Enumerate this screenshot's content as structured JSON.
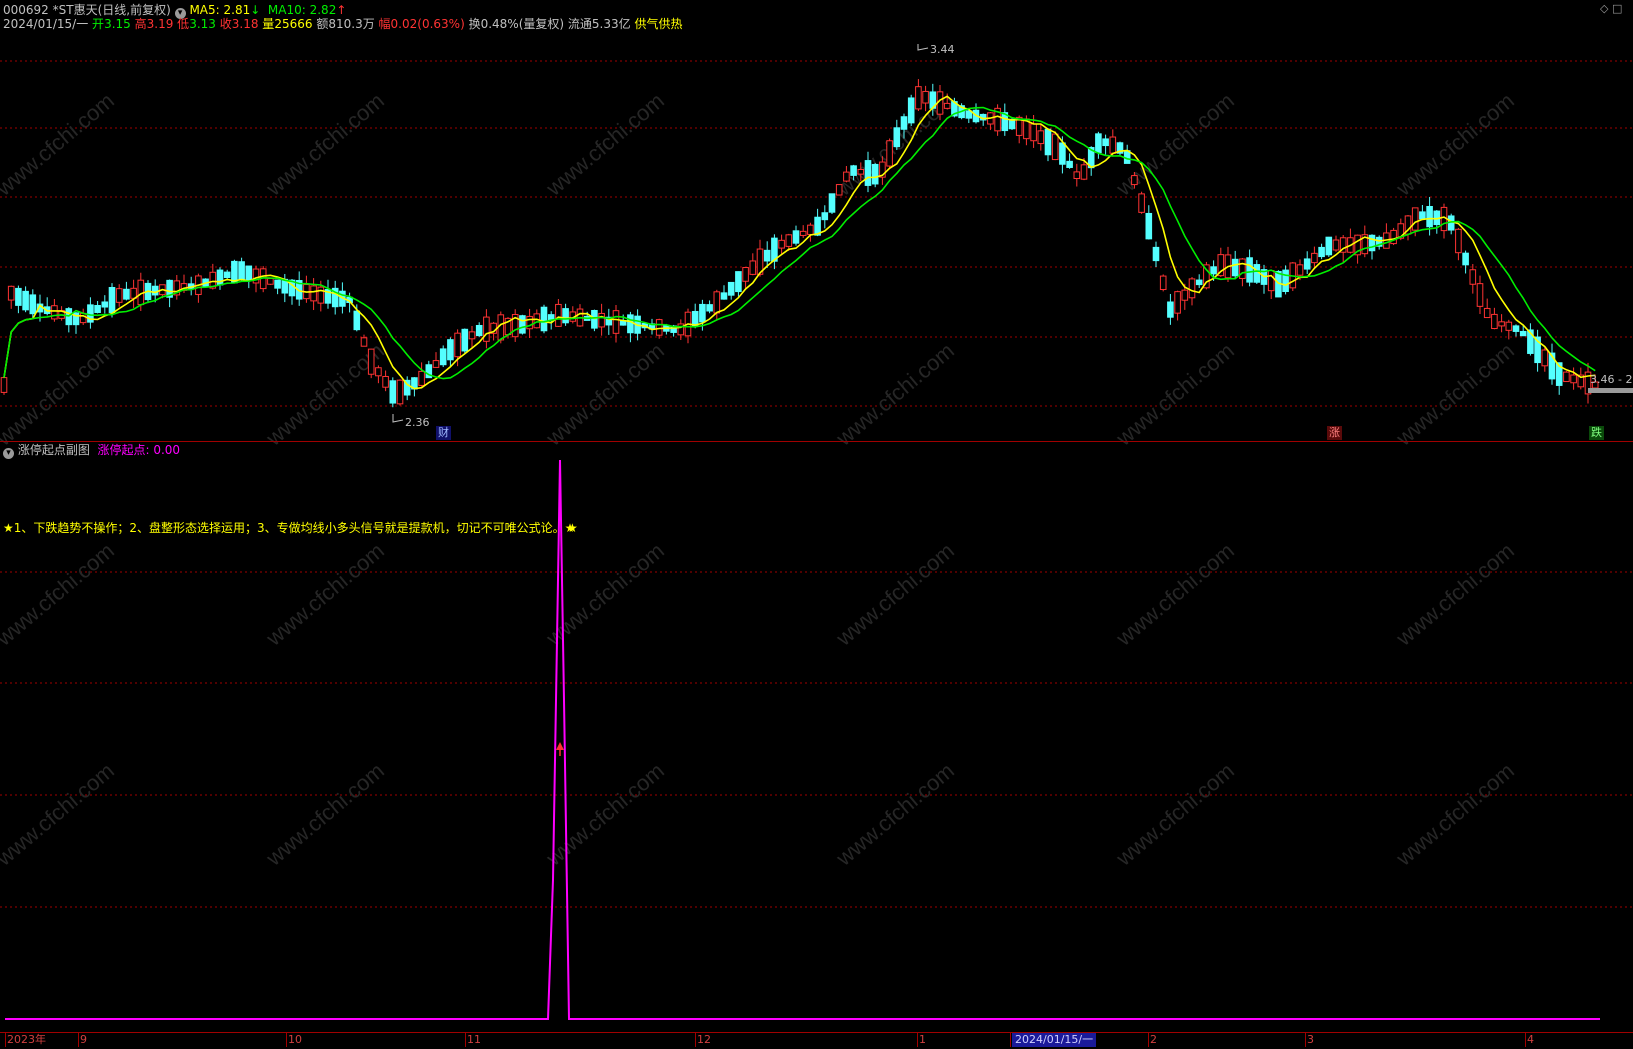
{
  "header": {
    "code": "000692",
    "name": "*ST惠天",
    "period": "(日线,前复权)",
    "ma5_label": "MA5: 2.81",
    "ma5_arrow": "↓",
    "ma10_label": "MA10: 2.82",
    "ma10_arrow": "↑",
    "date": "2024/01/15/一",
    "open_label": "开",
    "open_value": "3.15",
    "high_label": "高",
    "high_value": "3.19",
    "low_label": "低",
    "low_value": "3.13",
    "close_label": "收",
    "close_value": "3.18",
    "vol_label": "量",
    "vol_value": "25666",
    "amt_label": "额",
    "amt_value": "810.3万",
    "chg_label": "幅",
    "chg_value": "0.02(0.63%)",
    "turnover": "换0.48%(量复权)",
    "float": "流通5.33亿",
    "supply": "供气供热"
  },
  "main_chart": {
    "high_mark": "3.44",
    "low_mark": "2.36",
    "last_mark": "3.46 - 2",
    "tag_cai": "财",
    "tag_zhang": "涨",
    "tag_die": "跌"
  },
  "sub_chart": {
    "title": "涨停起点副图",
    "indicator": "涨停起点: 0.00",
    "notice": "★1、下跌趋势不操作；2、盘整形态选择运用；3、专做均线小多头信号就是提款机，切记不可唯公式论。★"
  },
  "timeline": {
    "labels": [
      "2023年",
      "9",
      "10",
      "11",
      "12",
      "1",
      "2024/01/15/一",
      "2",
      "3",
      "4"
    ]
  },
  "watermark": "www.cfchi.com",
  "colors": {
    "up": "#ff3333",
    "down": "#54ffff",
    "ma5": "#ffff00",
    "ma10": "#00ee00",
    "indicator": "#ff00ff",
    "grid": "#a00000",
    "notice": "#ffff00"
  },
  "chart_data": [
    {
      "type": "candlestick",
      "title": "000692 *ST惠天 (日线,前复权)",
      "series": [
        {
          "name": "MA5",
          "values": [
            2.81
          ]
        },
        {
          "name": "MA10",
          "values": [
            2.82
          ]
        }
      ],
      "annotations": [
        {
          "label": "3.44",
          "kind": "period high"
        },
        {
          "label": "2.36",
          "kind": "period low"
        }
      ],
      "x_range": [
        "2023-08",
        "2024-04"
      ]
    },
    {
      "type": "line",
      "title": "涨停起点副图",
      "series": [
        {
          "name": "涨停起点",
          "values": [
            0,
            0,
            1,
            0,
            0
          ]
        }
      ],
      "x": [
        "2023-08",
        "2023-11",
        "2023-11",
        "2023-11",
        "2024-04"
      ]
    }
  ]
}
